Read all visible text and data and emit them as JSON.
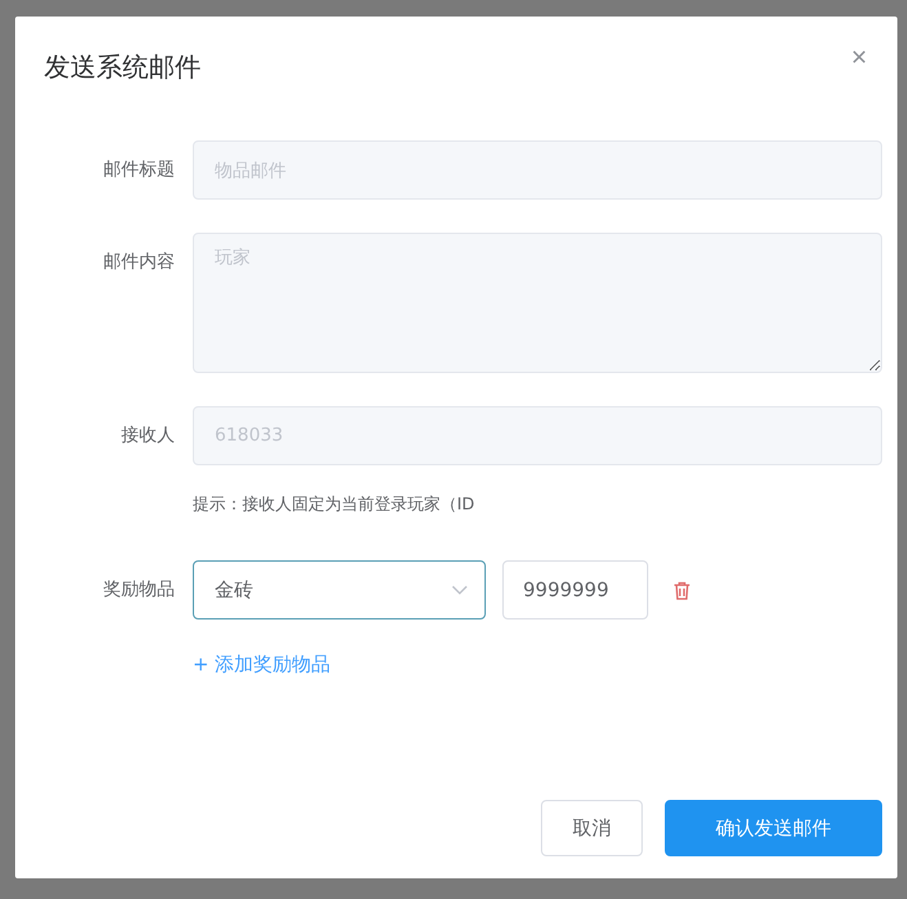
{
  "dialog": {
    "title": "发送系统邮件",
    "close": "×"
  },
  "fields": [
    {
      "label": "邮件标题",
      "kind": "input",
      "value": "物品邮件",
      "disabled": true
    },
    {
      "label": "邮件内容",
      "kind": "textarea",
      "value": "玩家",
      "disabled": true
    },
    {
      "label": "接收人",
      "kind": "input",
      "value": "618033",
      "disabled": true,
      "hint": "提示：接收人固定为当前登录玩家（ID"
    }
  ],
  "rewards": {
    "label": "奖励物品",
    "items": [
      {
        "item": "金砖",
        "quantity": "9999999"
      }
    ],
    "add": "+ 添加奖励物品"
  },
  "buttons": [
    {
      "label": "取消",
      "kind": "default"
    },
    {
      "label": "确认发送邮件",
      "kind": "primary"
    }
  ]
}
